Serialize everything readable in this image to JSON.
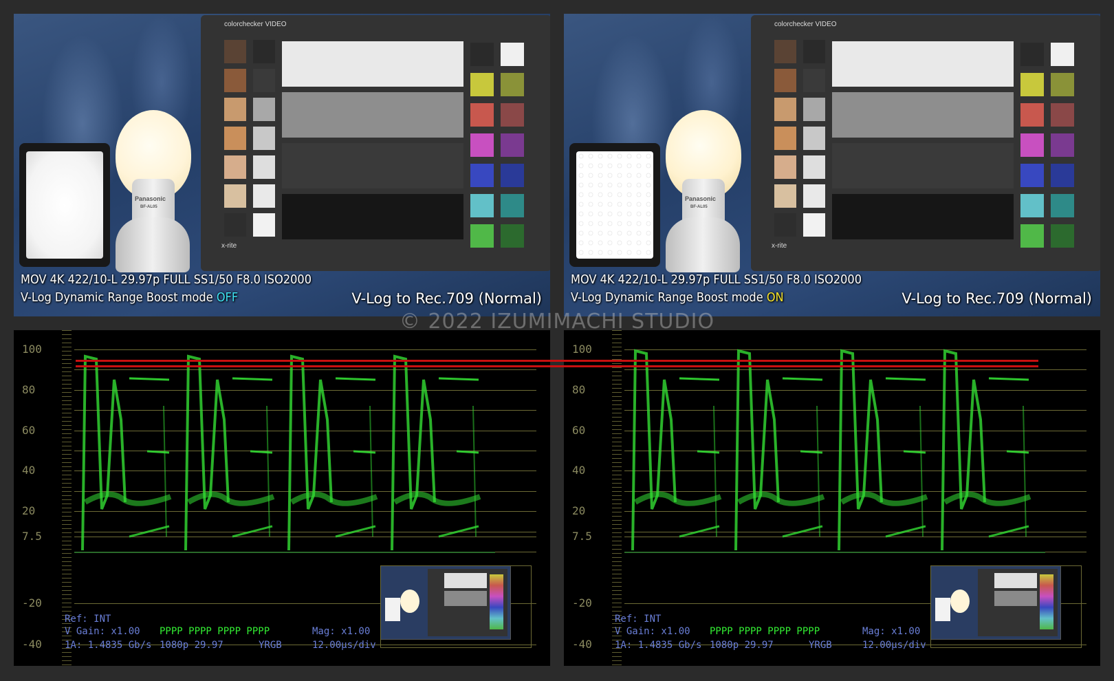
{
  "watermark": "© 2022 IZUMIMACHI STUDIO",
  "panels": [
    {
      "line1": "MOV  4K  422/10-L  29.97p  FULL  SS1/50  F8.0  ISO2000",
      "line2_prefix": "V-Log  Dynamic Range Boost mode ",
      "mode_state": "OFF",
      "mode_color": "#3ee0f0",
      "lut_label": "V-Log to Rec.709 (Normal)",
      "checker_logo": "colorchecker VIDEO",
      "xrite_logo": "x-rite",
      "bulb_brand": "Panasonic",
      "bulb_model": "BF-AL05"
    },
    {
      "line1": "MOV  4K  422/10-L  29.97p  FULL  SS1/50  F8.0  ISO2000",
      "line2_prefix": "V-Log  Dynamic Range Boost mode ",
      "mode_state": "ON",
      "mode_color": "#f4e02a",
      "lut_label": "V-Log to Rec.709 (Normal)",
      "checker_logo": "colorchecker VIDEO",
      "xrite_logo": "x-rite",
      "bulb_brand": "Panasonic",
      "bulb_model": "BF-AL05"
    }
  ],
  "scope": {
    "scale_labels": [
      "100",
      "80",
      "60",
      "40",
      "20",
      "7.5",
      "-20",
      "-40"
    ],
    "ref": "Ref: INT",
    "vgain": "V Gain:  x1.00",
    "pppp": "PPPP PPPP PPPP PPPP",
    "mag": "Mag:  x1.00",
    "link": "1A: 1.4835 Gb/s",
    "format": "1080p 29.97",
    "channels": "YRGB",
    "sweep": "12.00µs/div"
  },
  "colors": {
    "trace": "#33dd33",
    "clip_line": "#c81010",
    "status_text": "#6a7fd8"
  }
}
